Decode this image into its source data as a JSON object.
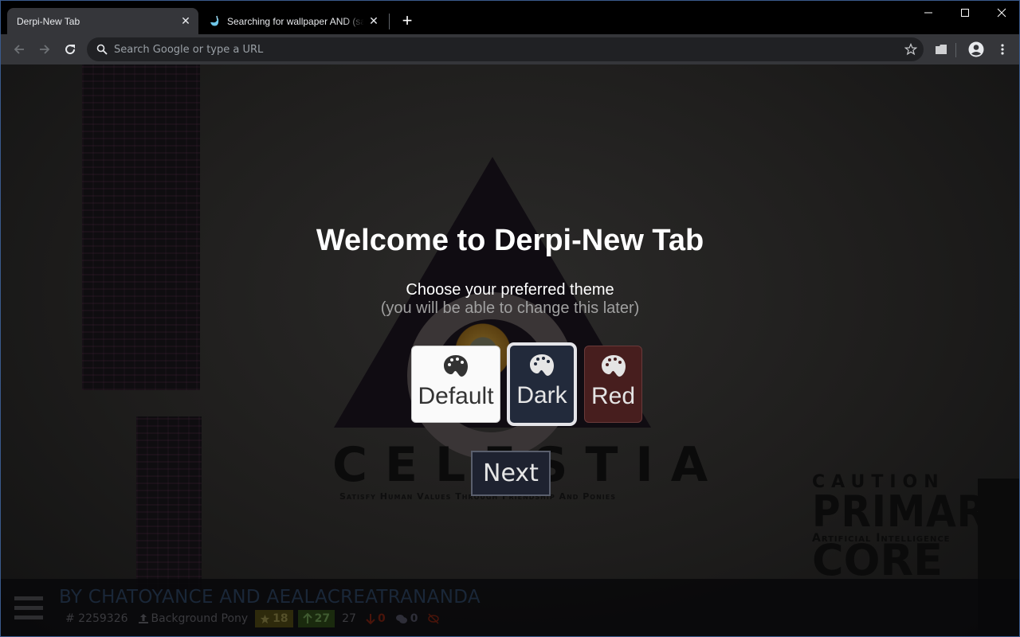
{
  "browser": {
    "tabs": [
      {
        "title": "Derpi-New Tab",
        "active": true
      },
      {
        "title": "Searching for wallpaper AND (safe",
        "active": false
      }
    ],
    "new_tab_label": "+",
    "omnibox": {
      "placeholder": "Search Google or type a URL",
      "value": ""
    },
    "icons": {
      "back": "arrow-left-icon",
      "forward": "arrow-right-icon",
      "reload": "reload-icon",
      "search": "search-icon",
      "bookmark": "star-icon",
      "extension": "folder-extension-icon",
      "profile": "account-icon",
      "menu": "kebab-menu-icon"
    }
  },
  "background_art": {
    "logo_word": "CELESTIA",
    "logo_motto": "Satisfy Human Values Through Friendship And Ponies",
    "caution_lines": [
      "CAUTION",
      "PRIMARY",
      "Artificial Intelligence",
      "CORE"
    ]
  },
  "onboarding": {
    "title": "Welcome to Derpi-New Tab",
    "subtitle": "Choose your preferred theme",
    "note": "(you will be able to change this later)",
    "themes": [
      {
        "label": "Default",
        "icon": "palette-icon",
        "selected": false,
        "color": "#fafafa"
      },
      {
        "label": "Dark",
        "icon": "palette-icon",
        "selected": true,
        "color": "#222a3b"
      },
      {
        "label": "Red",
        "icon": "palette-icon",
        "selected": false,
        "color": "#471e1e"
      }
    ],
    "next_label": "Next"
  },
  "image_info": {
    "artist_line": "BY CHATOYANCE AND AEALACREATRANANDA",
    "id": "# 2259326",
    "uploader": "Background Pony",
    "faves": "18",
    "upvotes": "27",
    "score": "27",
    "downvotes": "0",
    "comments": "0"
  }
}
